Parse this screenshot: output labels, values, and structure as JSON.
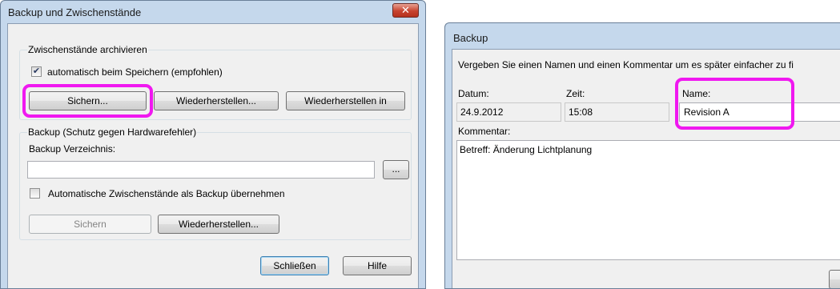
{
  "left_dialog": {
    "title": "Backup und Zwischenstände",
    "close_glyph": "✕",
    "archive_group": {
      "label": "Zwischenstände archivieren",
      "auto_save_label": "automatisch beim Speichern (empfohlen)",
      "auto_save_checked": true,
      "save_button": "Sichern...",
      "restore_button": "Wiederherstellen...",
      "restore_in_button": "Wiederherstellen in"
    },
    "backup_group": {
      "label": "Backup (Schutz gegen Hardwarefehler)",
      "directory_label": "Backup Verzeichnis:",
      "directory_value": "",
      "browse_button": "...",
      "auto_backup_label": "Automatische Zwischenstände als Backup übernehmen",
      "auto_backup_checked": false,
      "save_button": "Sichern",
      "restore_button": "Wiederherstellen..."
    },
    "close_button": "Schließen",
    "help_button": "Hilfe"
  },
  "right_dialog": {
    "title": "Backup",
    "instruction": "Vergeben Sie einen Namen und einen Kommentar um es später einfacher zu fi",
    "date_label": "Datum:",
    "date_value": "24.9.2012",
    "time_label": "Zeit:",
    "time_value": "15:08",
    "name_label": "Name:",
    "name_value": "Revision A",
    "comment_label": "Kommentar:",
    "comment_value": "Betreff: Änderung Lichtplanung"
  },
  "colors": {
    "highlight": "#f018f0",
    "title_bar": "#c5d8ec",
    "dialog_background": "#f0f0f0"
  }
}
